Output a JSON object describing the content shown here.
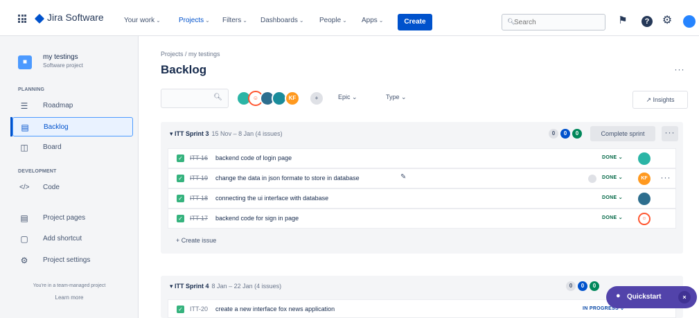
{
  "nav": {
    "product": "Jira Software",
    "links": [
      {
        "label": "Your work",
        "active": false
      },
      {
        "label": "Projects",
        "active": true
      },
      {
        "label": "Filters",
        "active": false
      },
      {
        "label": "Dashboards",
        "active": false
      },
      {
        "label": "People",
        "active": false
      },
      {
        "label": "Apps",
        "active": false
      }
    ],
    "create_label": "Create",
    "search_placeholder": "Search"
  },
  "sidebar": {
    "project_name": "my testings",
    "project_type": "Software project",
    "planning_label": "PLANNING",
    "development_label": "DEVELOPMENT",
    "items": [
      {
        "label": "Roadmap",
        "icon": "roadmap-icon"
      },
      {
        "label": "Backlog",
        "icon": "backlog-icon",
        "selected": true
      },
      {
        "label": "Board",
        "icon": "board-icon"
      },
      {
        "label": "Code",
        "icon": "code-icon"
      },
      {
        "label": "Project pages",
        "icon": "page-icon"
      },
      {
        "label": "Add shortcut",
        "icon": "shortcut-icon"
      },
      {
        "label": "Project settings",
        "icon": "gear-icon"
      }
    ],
    "footer_text": "You're in a team-managed project",
    "footer_link": "Learn more"
  },
  "main": {
    "breadcrumb": "Projects / my testings",
    "title": "Backlog",
    "filters": {
      "epic_label": "Epic",
      "type_label": "Type",
      "avatar_initials": "KF"
    },
    "insights_label": "Insights",
    "sprints": [
      {
        "name": "ITT Sprint 3",
        "meta": "15 Nov – 8 Jan  (4 issues)",
        "counts": [
          "0",
          "0",
          "0"
        ],
        "action_label": "Complete sprint",
        "issues": [
          {
            "key": "ITT-16",
            "summary": "backend code of login page",
            "status": "DONE",
            "assignee": ""
          },
          {
            "key": "ITT-19",
            "summary": "change the data in json formate to store in database",
            "status": "DONE",
            "assignee": "KF"
          },
          {
            "key": "ITT-18",
            "summary": "connecting the ui interface with database",
            "status": "DONE",
            "assignee": ""
          },
          {
            "key": "ITT-17",
            "summary": "backend code for sign in page",
            "status": "DONE",
            "assignee": ""
          }
        ],
        "create_issue_label": "+ Create issue"
      },
      {
        "name": "ITT Sprint 4",
        "meta": "8 Jan – 22 Jan  (4 issues)",
        "counts": [
          "0",
          "0",
          "0"
        ],
        "issues": [
          {
            "key": "ITT-20",
            "summary": "create a new interface fox news application",
            "status": "IN PROGRESS",
            "assignee": ""
          }
        ]
      }
    ]
  },
  "quickstart": {
    "label": "Quickstart",
    "close": "×"
  },
  "colors": {
    "brand": "#0052cc",
    "done": "#006644",
    "sprint_bg": "#f4f5f7",
    "quickstart": "#5243aa"
  }
}
